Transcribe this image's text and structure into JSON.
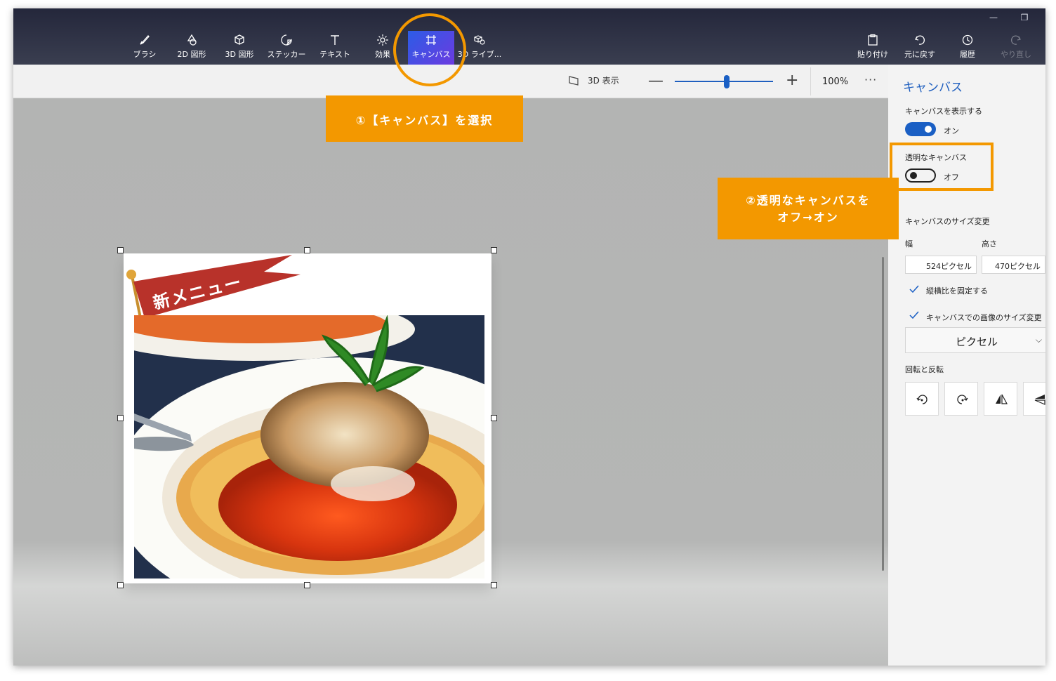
{
  "toolbar": {
    "items": [
      {
        "label": "ブラシ",
        "icon": "brush-icon"
      },
      {
        "label": "2D 図形",
        "icon": "2d-shapes-icon"
      },
      {
        "label": "3D 図形",
        "icon": "3d-shapes-icon"
      },
      {
        "label": "ステッカー",
        "icon": "sticker-icon"
      },
      {
        "label": "テキスト",
        "icon": "text-icon"
      },
      {
        "label": "効果",
        "icon": "effects-icon"
      },
      {
        "label": "キャンバス",
        "icon": "canvas-icon"
      },
      {
        "label": "3D ライブ...",
        "icon": "3d-library-icon"
      }
    ],
    "right_items": [
      {
        "label": "貼り付け",
        "icon": "paste-icon"
      },
      {
        "label": "元に戻す",
        "icon": "undo-icon"
      },
      {
        "label": "履歴",
        "icon": "history-icon"
      },
      {
        "label": "やり直し",
        "icon": "redo-icon"
      }
    ],
    "active": "キャンバス"
  },
  "subbar": {
    "view3d_label": "3D 表示",
    "zoom_minus": "—",
    "zoom_plus": "+",
    "zoom_level": "100%",
    "zoom_fraction": 0.5,
    "more": "···"
  },
  "canvas": {
    "flag_text": "新メニュー"
  },
  "panel": {
    "title": "キャンバス",
    "show_canvas_label": "キャンバスを表示する",
    "show_canvas_state": "オン",
    "transparent_label": "透明なキャンバス",
    "transparent_state": "オフ",
    "resize_label": "キャンバスのサイズ変更",
    "width_label": "幅",
    "height_label": "高さ",
    "width_value": "524ピクセル",
    "height_value": "470ピクセル",
    "lock_aspect_label": "縦横比を固定する",
    "resize_image_label": "キャンバスでの画像のサイズ変更",
    "unit_value": "ピクセル",
    "rotate_label": "回転と反転"
  },
  "annotations": {
    "callout1": "①【キャンバス】を選択",
    "callout2_line1": "②透明なキャンバスを",
    "callout2_line2": "オフ→オン"
  },
  "colors": {
    "accent": "#1a5fc4",
    "annotation": "#f39800",
    "toolbar_dark": "#24273b"
  }
}
